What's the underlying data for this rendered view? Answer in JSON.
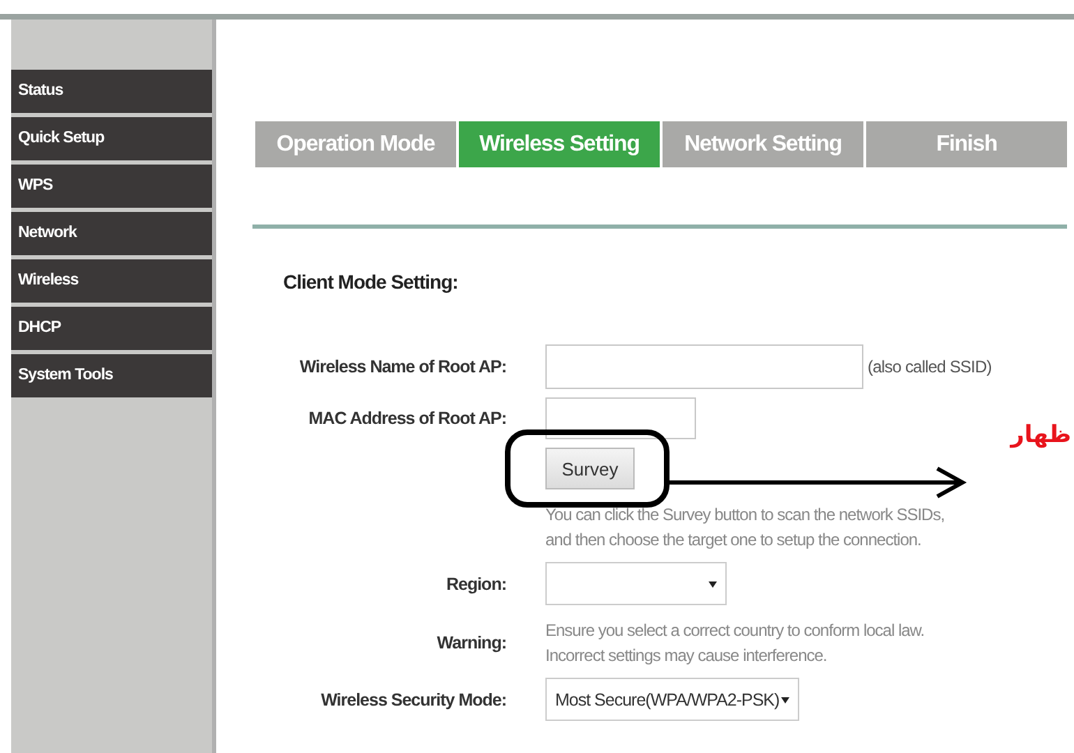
{
  "sidebar": {
    "items": [
      {
        "label": "Status"
      },
      {
        "label": "Quick Setup"
      },
      {
        "label": "WPS"
      },
      {
        "label": "Network"
      },
      {
        "label": "Wireless"
      },
      {
        "label": "DHCP"
      },
      {
        "label": "System Tools"
      }
    ]
  },
  "wizard_tabs": [
    {
      "label": "Operation Mode",
      "selected": false
    },
    {
      "label": "Wireless Setting",
      "selected": true
    },
    {
      "label": "Network Setting",
      "selected": false
    },
    {
      "label": "Finish",
      "selected": false
    }
  ],
  "section_title": "Client Mode Setting:",
  "form": {
    "rows": [
      {
        "kind": "text",
        "label": "Wireless Name of Root AP:",
        "note": "(also called SSID)"
      },
      {
        "kind": "text",
        "label": "MAC Address of Root AP:"
      },
      {
        "kind": "button",
        "button": "Survey"
      },
      {
        "kind": "hint",
        "lines": [
          "You can click the Survey button to scan the network SSIDs,",
          "and then choose the target one to setup the connection."
        ]
      },
      {
        "kind": "select",
        "label": "Region:"
      },
      {
        "kind": "hint",
        "label": "Warning:",
        "lines": [
          "Ensure you select a correct country to conform local law.",
          "Incorrect settings may cause interference."
        ]
      },
      {
        "kind": "select",
        "label": "Wireless Security Mode:",
        "value": "Most Secure(WPA/WPA2-PSK)"
      }
    ]
  },
  "annotation": {
    "text": "ظهار"
  }
}
